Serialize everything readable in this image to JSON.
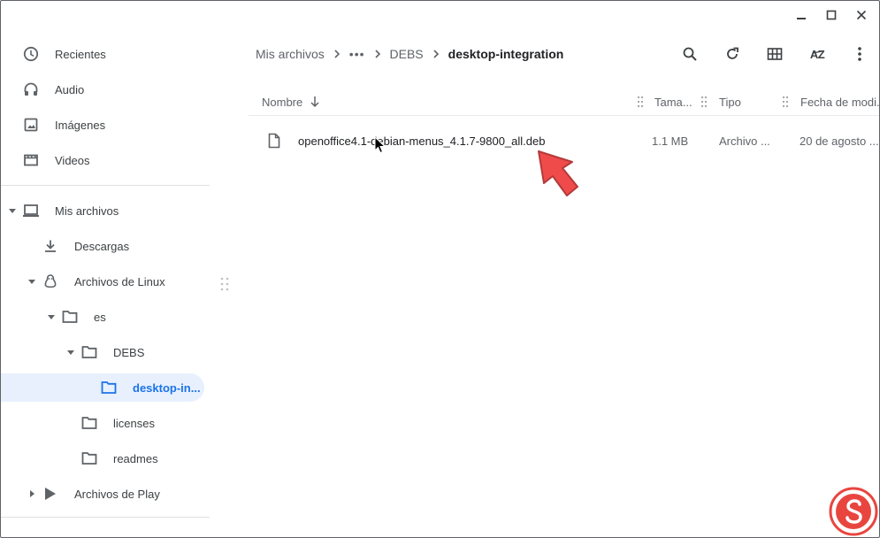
{
  "window": {
    "controls": [
      "minimize-icon",
      "maximize-icon",
      "close-icon"
    ]
  },
  "sidebar": {
    "items": [
      {
        "label": "Recientes",
        "icon": "clock-icon"
      },
      {
        "label": "Audio",
        "icon": "headphones-icon"
      },
      {
        "label": "Imágenes",
        "icon": "image-icon"
      },
      {
        "label": "Videos",
        "icon": "movie-icon"
      },
      {
        "label": "Mis archivos",
        "icon": "laptop-icon"
      },
      {
        "label": "Descargas",
        "icon": "download-icon"
      },
      {
        "label": "Archivos de Linux",
        "icon": "linux-penguin-icon"
      },
      {
        "label": "es",
        "icon": "folder-icon"
      },
      {
        "label": "DEBS",
        "icon": "folder-icon"
      },
      {
        "label": "desktop-in...",
        "icon": "folder-icon"
      },
      {
        "label": "licenses",
        "icon": "folder-icon"
      },
      {
        "label": "readmes",
        "icon": "folder-icon"
      },
      {
        "label": "Archivos de Play",
        "icon": "play-store-icon"
      }
    ],
    "selected_color": "#1a73e8"
  },
  "breadcrumb": {
    "root": "Mis archivos",
    "ellipsis": "•••",
    "parent": "DEBS",
    "current": "desktop-integration"
  },
  "toolbar": {
    "sort_label": "AZ"
  },
  "table": {
    "columns": [
      "Nombre",
      "Tama...",
      "Tipo",
      "Fecha de modi..."
    ],
    "rows": [
      {
        "name": "openoffice4.1-debian-menus_4.1.7-9800_all.deb",
        "size": "1.1 MB",
        "type": "Archivo ...",
        "date": "20 de agosto ..."
      }
    ]
  },
  "colors": {
    "accent": "#1a73e8",
    "arrow": "#f04b4b",
    "watermark": "#e9453f"
  }
}
